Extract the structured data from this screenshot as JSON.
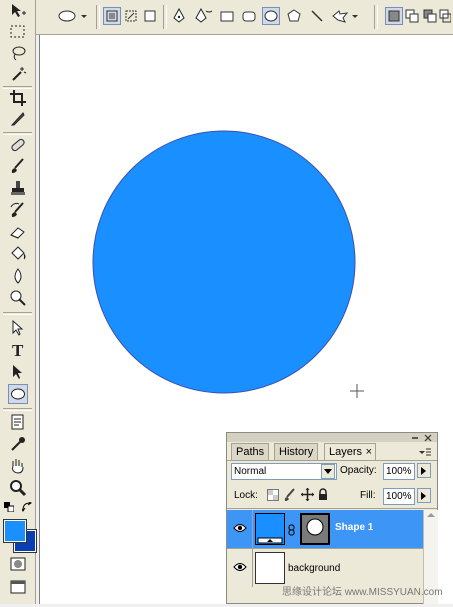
{
  "colors": {
    "shape_fill": "#1a8fff",
    "shape_stroke": "#3d4fb0",
    "foreground": "#1a8fff",
    "background": "#0a3fb3",
    "layer_selected": "#3d95f5"
  },
  "options_bar": {
    "icons": [
      "ellipse-icon",
      "shape-layers-icon",
      "paths-icon",
      "fill-pixels-icon",
      "pen-icon",
      "freeform-pen-icon",
      "rectangle-icon",
      "rounded-rectangle-icon",
      "ellipse-shape-icon",
      "polygon-icon",
      "line-icon",
      "custom-shape-icon",
      "new-layer-icon",
      "add-icon",
      "subtract-icon"
    ]
  },
  "layers_panel": {
    "tabs": [
      {
        "label": "Paths"
      },
      {
        "label": "History"
      },
      {
        "label": "Layers"
      }
    ],
    "blend_mode": "Normal",
    "opacity_label": "Opacity:",
    "opacity_value": "100%",
    "lock_label": "Lock:",
    "fill_label": "Fill:",
    "fill_value": "100%",
    "layers": [
      {
        "name": "Shape 1",
        "selected": true
      },
      {
        "name": "background",
        "selected": false
      }
    ]
  },
  "watermark": "思缘设计论坛  www.MISSYUAN.com"
}
